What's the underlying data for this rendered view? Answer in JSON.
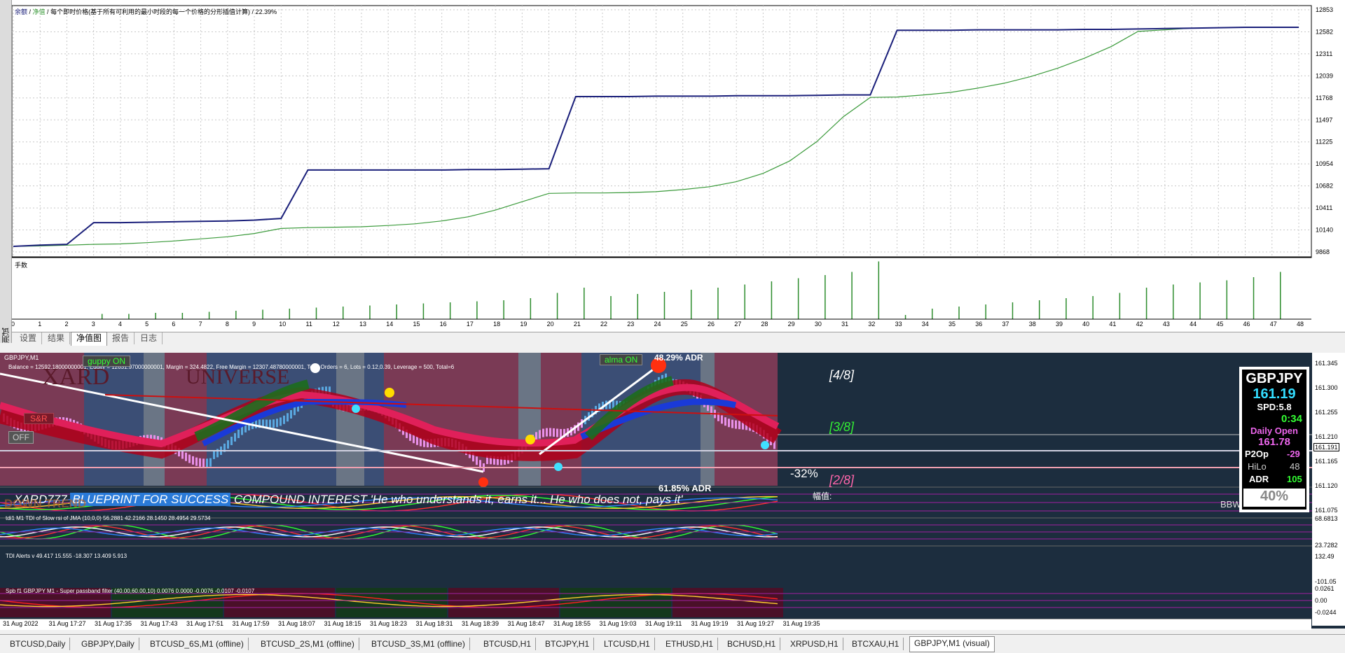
{
  "tester": {
    "sidebar_label": "测试",
    "header": {
      "part1": "余额",
      "part2": "净值",
      "rest": "每个即时价格(基于所有可利用的最小时段的每一个价格的分形插值计算) / 22.39%"
    },
    "colors": {
      "balance": "#1a1f7a",
      "equity": "#3a9a3a"
    },
    "y_ticks": [
      "12853",
      "12582",
      "12311",
      "12039",
      "11768",
      "11497",
      "11225",
      "10954",
      "10682",
      "10411",
      "10140",
      "9868"
    ],
    "volume_label": "手数",
    "x_ticks": [
      "0",
      "1",
      "2",
      "3",
      "4",
      "5",
      "6",
      "7",
      "8",
      "9",
      "10",
      "11",
      "12",
      "13",
      "14",
      "15",
      "16",
      "17",
      "18",
      "19",
      "20",
      "21",
      "22",
      "23",
      "24",
      "25",
      "26",
      "27",
      "28",
      "29",
      "30",
      "31",
      "32",
      "33",
      "34",
      "35",
      "36",
      "37",
      "38",
      "39",
      "40",
      "41",
      "42",
      "43",
      "44",
      "45",
      "46",
      "47",
      "48"
    ],
    "tabs": [
      {
        "label": "设置"
      },
      {
        "label": "结果"
      },
      {
        "label": "净值图"
      },
      {
        "label": "报告"
      },
      {
        "label": "日志"
      }
    ],
    "active_tab": "净值图"
  },
  "chart_data": {
    "type": "line",
    "title": "每个即时价格(基于所有可利用的最小时段的每一个价格的分形插值计算) / 22.39%",
    "x": [
      0,
      1,
      2,
      3,
      4,
      5,
      6,
      7,
      8,
      9,
      10,
      11,
      12,
      13,
      14,
      15,
      16,
      17,
      18,
      19,
      20,
      21,
      22,
      23,
      24,
      25,
      26,
      27,
      28,
      29,
      30,
      31,
      32,
      33,
      34,
      35,
      36,
      37,
      38,
      39,
      40,
      41,
      42,
      43,
      44,
      45,
      46,
      47,
      48
    ],
    "series": [
      {
        "name": "余额",
        "values": [
          9985,
          10000,
          10010,
          10270,
          10270,
          10275,
          10280,
          10285,
          10290,
          10300,
          10320,
          10900,
          10900,
          10900,
          10900,
          10900,
          10900,
          10905,
          10905,
          10910,
          10915,
          11780,
          11780,
          11780,
          11785,
          11785,
          11785,
          11790,
          11790,
          11790,
          11795,
          11800,
          11800,
          12575,
          12575,
          12575,
          12580,
          12580,
          12580,
          12580,
          12585,
          12585,
          12590,
          12595,
          12600,
          12605,
          12610,
          12610,
          12610
        ]
      },
      {
        "name": "净值",
        "values": [
          9985,
          9990,
          10000,
          10010,
          10015,
          10030,
          10050,
          10075,
          10100,
          10140,
          10200,
          10210,
          10215,
          10220,
          10235,
          10255,
          10290,
          10340,
          10420,
          10520,
          10620,
          10625,
          10625,
          10630,
          10640,
          10665,
          10700,
          10760,
          10860,
          11010,
          11240,
          11540,
          11770,
          11775,
          11800,
          11830,
          11880,
          11940,
          12020,
          12120,
          12240,
          12380,
          12560,
          12580,
          12600,
          12605,
          12610,
          12610,
          12610
        ]
      }
    ],
    "volume": [
      0,
      0,
      0,
      0.05,
      0.05,
      0.06,
      0.06,
      0.07,
      0.08,
      0.09,
      0.1,
      0.11,
      0.12,
      0.13,
      0.14,
      0.15,
      0.16,
      0.17,
      0.18,
      0.2,
      0.25,
      0.3,
      0.22,
      0.24,
      0.26,
      0.28,
      0.3,
      0.33,
      0.36,
      0.39,
      0.42,
      0.45,
      0.55,
      0.04,
      0.1,
      0.12,
      0.14,
      0.16,
      0.18,
      0.2,
      0.22,
      0.25,
      0.3,
      0.33,
      0.35,
      0.37,
      0.4,
      0.45,
      0
    ],
    "ylim": [
      9868,
      12853
    ],
    "grid": true
  },
  "market": {
    "symbol_label": "GBPJPY,M1",
    "account_line": "Balance = 12592.18000000001, Equity = 12631.97000000001, Margin = 324.4822, Free Margin = 12307.48780000001, Total Orders = 6, Lots = 0.12,0.39, Leverage = 500, Total=6",
    "guppy_badge": "guppy ON",
    "alma_badge": "alma ON",
    "xard_watermark": "XARD",
    "universe_watermark": "UNIVERSE",
    "sr_label": "S&R",
    "off_button": "OFF",
    "adr_top": "48.29% ADR",
    "adr_mid": "61.85% ADR",
    "pct_label": "-32%",
    "murrey": [
      "[4/8]",
      "[3/8]",
      "[2/8]"
    ],
    "fee_label": "幅值:",
    "banner_brand": "XARD777",
    "banner_blueprint": "BLUEPRINT FOR SUCCESS",
    "banner_rest": "COMPOUND INTEREST 'He who understands it, earns it... He who does not, pays it'",
    "down_label": "DOWN TREND",
    "bbw_label": "BBW",
    "price_ticks": [
      "161.345",
      "161.300",
      "161.255",
      "161.210",
      "161.165",
      "161.120",
      "161.075"
    ],
    "current_price_tag": "161.191",
    "info": {
      "symbol": "GBPJPY",
      "price": "161.19",
      "spread": "SPD:5.8",
      "timer": "0:34",
      "daily_open_label": "Daily Open",
      "daily_open": "161.78",
      "p20_label": "P2Op",
      "p20_value": "-29",
      "hilo_label": "HiLo",
      "hilo_value": "48",
      "adr_label": "ADR",
      "adr_value": "105",
      "pct": "40%"
    },
    "tdi1_label": "tdi1 M1 TDI of Slow rsi of JMA (10,0,0) 56.2881 42.2166 28.1450 28.4954 29.5734",
    "tdi1_ticks": [
      "68.6813",
      "23.7282"
    ],
    "tdi2_label": "TDI Alerts v 49.417 15.555 -18.307 13.409 5.913",
    "tdi2_ticks": [
      "132.49",
      "-101.05"
    ],
    "spb_label": "Spb f1 GBPJPY M1 - Super passband filter (40.00,60.00,10) 0.0076 0.0000 -0.0076 -0.0107 -0.0107",
    "spb_ticks": [
      "0.0261",
      "0.00",
      "-0.0244"
    ],
    "time_ticks": [
      "31 Aug 2022",
      "31 Aug 17:27",
      "31 Aug 17:35",
      "31 Aug 17:43",
      "31 Aug 17:51",
      "31 Aug 17:59",
      "31 Aug 18:07",
      "31 Aug 18:15",
      "31 Aug 18:23",
      "31 Aug 18:31",
      "31 Aug 18:39",
      "31 Aug 18:47",
      "31 Aug 18:55",
      "31 Aug 19:03",
      "31 Aug 19:11",
      "31 Aug 19:19",
      "31 Aug 19:27",
      "31 Aug 19:35"
    ]
  },
  "bottom_tabs": [
    {
      "label": "BTCUSD,Daily"
    },
    {
      "label": "GBPJPY,Daily"
    },
    {
      "label": "BTCUSD_6S,M1 (offline)"
    },
    {
      "label": "BTCUSD_2S,M1 (offline)"
    },
    {
      "label": "BTCUSD_3S,M1 (offline)"
    },
    {
      "label": "BTCUSD,H1"
    },
    {
      "label": "BTCJPY,H1"
    },
    {
      "label": "LTCUSD,H1"
    },
    {
      "label": "ETHUSD,H1"
    },
    {
      "label": "BCHUSD,H1"
    },
    {
      "label": "XRPUSD,H1"
    },
    {
      "label": "BTCXAU,H1"
    },
    {
      "label": "GBPJPY,M1 (visual)"
    }
  ],
  "active_bottom_tab": "GBPJPY,M1 (visual)"
}
